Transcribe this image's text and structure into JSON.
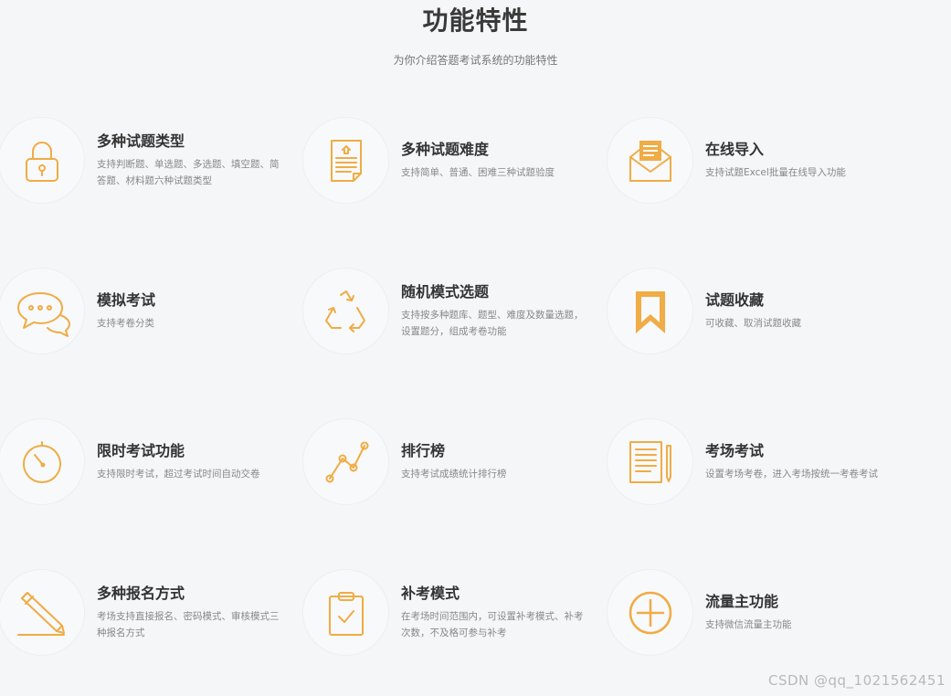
{
  "header": {
    "title": "功能特性",
    "subtitle": "为你介绍答题考试系统的功能特性"
  },
  "accent_color": "#f0ac45",
  "features": [
    {
      "title": "多种试题类型",
      "desc": "支持判断题、单选题、多选题、填空题、简答题、材料题六种试题类型",
      "icon": "lock-icon"
    },
    {
      "title": "多种试题难度",
      "desc": "支持简单、普通、困难三种试题验度",
      "icon": "document-icon"
    },
    {
      "title": "在线导入",
      "desc": "支持试题Excel批量在线导入功能",
      "icon": "envelope-icon"
    },
    {
      "title": "模拟考试",
      "desc": "支持考卷分类",
      "icon": "chat-bubbles-icon"
    },
    {
      "title": "随机模式选题",
      "desc": "支持按多种题库、题型、难度及数量选题，设置题分，组成考卷功能",
      "icon": "recycle-icon"
    },
    {
      "title": "试题收藏",
      "desc": "可收藏、取消试题收藏",
      "icon": "bookmark-icon"
    },
    {
      "title": "限时考试功能",
      "desc": "支持限时考试，超过考试时间自动交卷",
      "icon": "timer-icon"
    },
    {
      "title": "排行榜",
      "desc": "支持考试成绩统计排行榜",
      "icon": "line-chart-icon"
    },
    {
      "title": "考场考试",
      "desc": "设置考场考卷，进入考场按统一考卷考试",
      "icon": "notepad-pen-icon"
    },
    {
      "title": "多种报名方式",
      "desc": "考场支持直接报名、密码模式、审核模式三种报名方式",
      "icon": "pencil-icon"
    },
    {
      "title": "补考模式",
      "desc": "在考场时间范围内，可设置补考模式、补考次数，不及格可参与补考",
      "icon": "clipboard-check-icon"
    },
    {
      "title": "流量主功能",
      "desc": "支持微信流量主功能",
      "icon": "plus-circle-icon"
    }
  ],
  "watermark": "CSDN @qq_1021562451"
}
